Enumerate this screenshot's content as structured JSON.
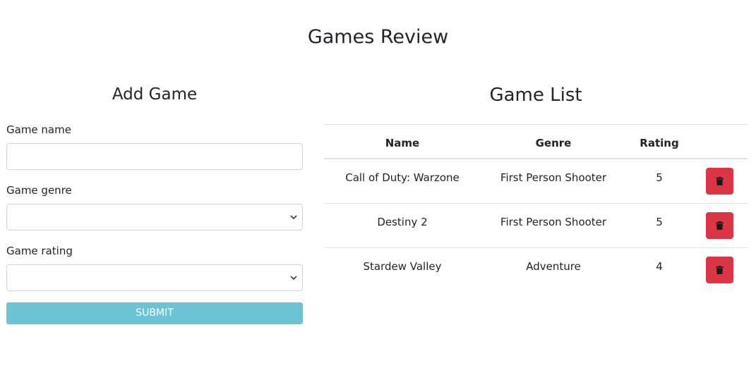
{
  "page": {
    "title": "Games Review"
  },
  "form": {
    "title": "Add Game",
    "name_label": "Game name",
    "name_value": "",
    "genre_label": "Game genre",
    "genre_selected": "",
    "rating_label": "Game rating",
    "rating_selected": "",
    "submit_label": "SUBMIT",
    "submit_color": "#6bc3d3"
  },
  "list": {
    "title": "Game List",
    "columns": [
      "Name",
      "Genre",
      "Rating"
    ],
    "rows": [
      {
        "name": "Call of Duty: Warzone",
        "genre": "First Person Shooter",
        "rating": "5"
      },
      {
        "name": "Destiny 2",
        "genre": "First Person Shooter",
        "rating": "5"
      },
      {
        "name": "Stardew Valley",
        "genre": "Adventure",
        "rating": "4"
      }
    ],
    "delete_icon": "trash-icon",
    "delete_color": "#dc3545"
  }
}
